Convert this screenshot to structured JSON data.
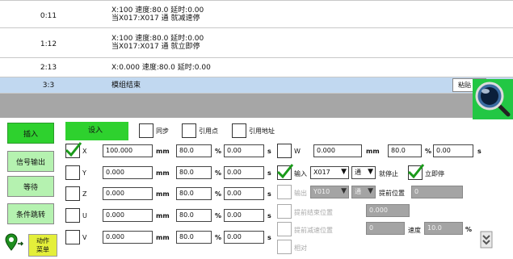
{
  "program_rows": [
    {
      "step": "0:11",
      "line1": "X:100 速度:80.0 延时:0.00",
      "line2": "当X017:X017 通 就减速停"
    },
    {
      "step": "1:12",
      "line1": "X:100 速度:80.0 延时:0.00",
      "line2": "当X017:X017 通 就立即停"
    },
    {
      "step": "2:13",
      "line1": "X:0.000 速度:80.0 延时:0.00",
      "line2": ""
    },
    {
      "step": "3:3",
      "line1": "模组结束",
      "line2": ""
    }
  ],
  "paste_button": "粘贴",
  "sidebar": {
    "insert": "插入",
    "signal_output": "信号输出",
    "wait": "等待",
    "conditional_jump": "条件跳转",
    "action_menu": "动作菜单"
  },
  "tabs": {
    "set_in": "设入",
    "sync": "同步",
    "ref_point": "引用点",
    "ref_address": "引用地址"
  },
  "axes": [
    {
      "name": "X",
      "checked": true,
      "position": "100.000",
      "speed": "80.0",
      "delay": "0.00"
    },
    {
      "name": "Y",
      "checked": false,
      "position": "0.000",
      "speed": "80.0",
      "delay": "0.00"
    },
    {
      "name": "Z",
      "checked": false,
      "position": "0.000",
      "speed": "80.0",
      "delay": "0.00"
    },
    {
      "name": "U",
      "checked": false,
      "position": "0.000",
      "speed": "80.0",
      "delay": "0.00"
    },
    {
      "name": "V",
      "checked": false,
      "position": "0.000",
      "speed": "80.0",
      "delay": "0.00"
    }
  ],
  "units": {
    "position": "mm",
    "speed": "%",
    "delay": "s"
  },
  "w_axis": {
    "name": "W",
    "position": "0.000",
    "speed": "80.0",
    "delay": "0.00"
  },
  "input_row": {
    "label": "输入",
    "port": "X017",
    "state": "通",
    "stop_label": "就停止",
    "immediate": "立即停"
  },
  "output_row": {
    "label": "输出",
    "port": "Y010",
    "state": "通",
    "advance_label": "提前位置",
    "advance_value": "0"
  },
  "advance_end": {
    "label": "提前结束位置",
    "value": "0.000"
  },
  "advance_decel": {
    "label": "提前减速位置",
    "value": "0",
    "speed_label": "速度",
    "speed_value": "10.0",
    "unit": "%"
  },
  "relative": {
    "label": "相对"
  },
  "colors": {
    "selected_row": "#c1d8f0",
    "gray_band": "#a6a6a6",
    "green_tab": "#2ed12e",
    "light_green": "#b5f2b0"
  }
}
